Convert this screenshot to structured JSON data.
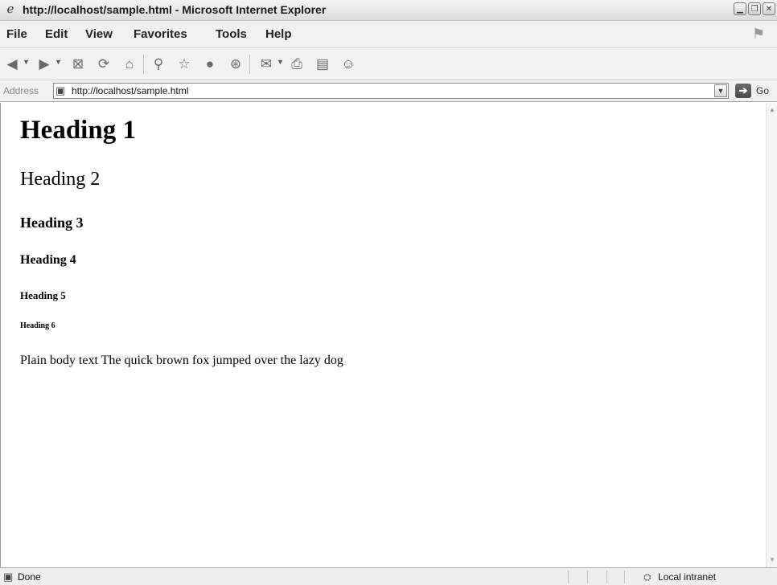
{
  "window": {
    "title": "http://localhost/sample.html - Microsoft Internet Explorer",
    "controls": [
      "minimize",
      "restore",
      "close"
    ]
  },
  "menubar": {
    "items": [
      "File",
      "Edit",
      "View",
      "Favorites",
      "Tools",
      "Help"
    ]
  },
  "toolbar": {
    "icons": [
      "back-icon",
      "forward-icon",
      "stop-icon",
      "refresh-icon",
      "home-icon",
      "search-icon",
      "favorites-icon",
      "media-icon",
      "history-icon",
      "mail-icon",
      "print-icon",
      "edit-icon",
      "messenger-icon"
    ]
  },
  "address": {
    "label": "Address",
    "url": "http://localhost/sample.html",
    "go_label": "Go"
  },
  "page": {
    "h1": "Heading 1",
    "h2": "Heading 2",
    "h3": "Heading 3",
    "h4": "Heading 4",
    "h5": "Heading 5",
    "h6": "Heading 6",
    "body_text": "Plain body text The quick brown fox jumped over the lazy dog"
  },
  "status": {
    "text": "Done",
    "zone": "Local intranet"
  }
}
